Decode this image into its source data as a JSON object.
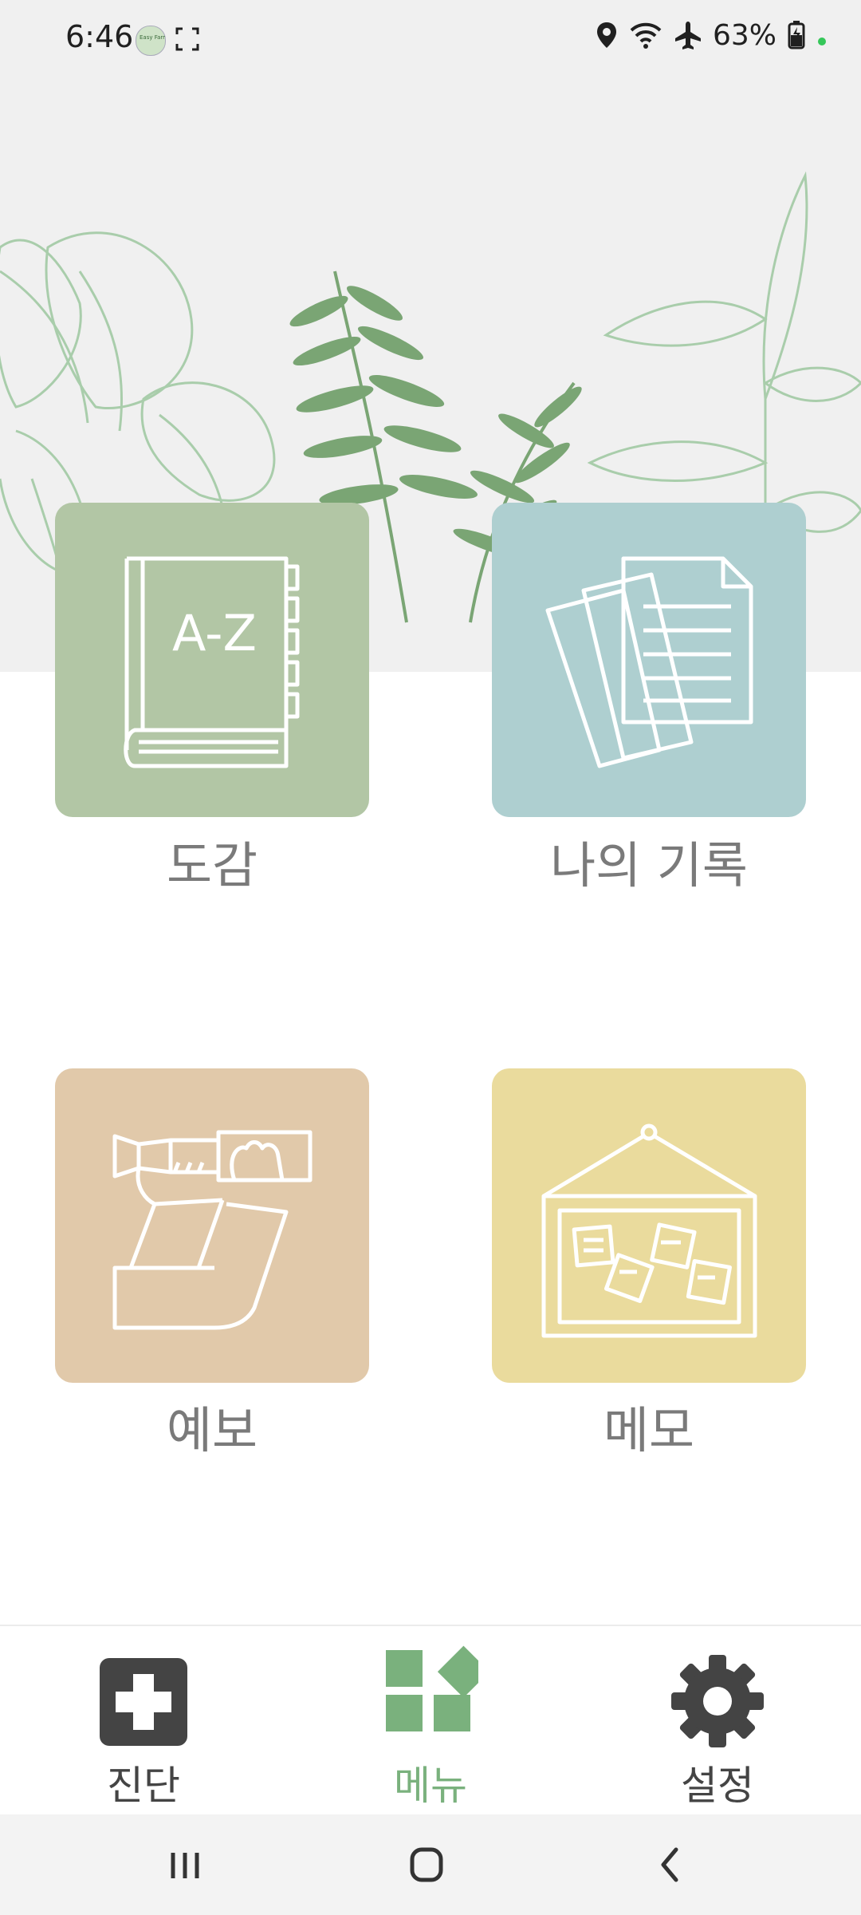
{
  "status_bar": {
    "time": "6:46",
    "app_thumb_text": "Easy Farm",
    "battery": "63%"
  },
  "menu": {
    "tiles": [
      {
        "label": "도감",
        "color": "#b2c6a5",
        "icon": "dictionary-book-icon"
      },
      {
        "label": "나의 기록",
        "color": "#aecfd0",
        "icon": "documents-icon"
      },
      {
        "label": "예보",
        "color": "#e1c9aa",
        "icon": "telescope-icon"
      },
      {
        "label": "메모",
        "color": "#eadb9d",
        "icon": "memo-board-icon"
      }
    ],
    "book_text": "A-Z"
  },
  "bottom_nav": {
    "items": [
      {
        "label": "진단",
        "icon": "medical-cross-icon",
        "active": false
      },
      {
        "label": "메뉴",
        "icon": "menu-blocks-icon",
        "active": true
      },
      {
        "label": "설정",
        "icon": "gear-icon",
        "active": false
      }
    ],
    "active_color": "#7ab17d",
    "inactive_color": "#444444"
  },
  "system_nav": {
    "buttons": [
      "recent-apps-icon",
      "home-icon",
      "back-icon"
    ]
  }
}
